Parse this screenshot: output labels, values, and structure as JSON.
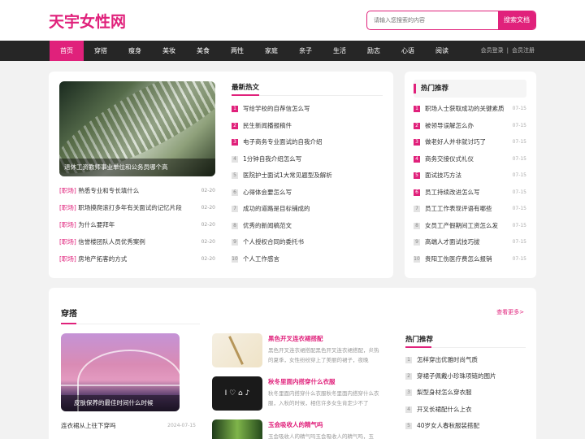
{
  "logo": "天宇女性网",
  "search": {
    "placeholder": "请输入您搜索的内容",
    "button": "搜索文档"
  },
  "nav": {
    "items": [
      "首页",
      "穿搭",
      "瘦身",
      "美妆",
      "美食",
      "两性",
      "家庭",
      "亲子",
      "生活",
      "励志",
      "心语",
      "阅读"
    ],
    "login": "会员登录",
    "register": "会员注册"
  },
  "feature": {
    "caption": "退休工资教师事业单位和公务员哪个高"
  },
  "left_list": [
    {
      "tag": "[职场]",
      "title": "熟悉专业和专长填什么",
      "date": "02-20"
    },
    {
      "tag": "[职场]",
      "title": "职场摸爬滚打多年有关面试的记忆片段",
      "date": "02-20"
    },
    {
      "tag": "[职场]",
      "title": "为什么要拜年",
      "date": "02-20"
    },
    {
      "tag": "[职场]",
      "title": "信誉楼团队人员优秀案例",
      "date": "02-20"
    },
    {
      "tag": "[职场]",
      "title": "房地产拓客的方式",
      "date": "02-20"
    }
  ],
  "latest": {
    "title": "最新热文",
    "items": [
      {
        "n": "1",
        "title": "写给学校的自荐信怎么写"
      },
      {
        "n": "2",
        "title": "民生新闻播报稿件"
      },
      {
        "n": "3",
        "title": "电子商务专业面试的自我介绍"
      },
      {
        "n": "4",
        "title": "1分钟自我介绍怎么写"
      },
      {
        "n": "5",
        "title": "医院护士面试1大常见题型及解析"
      },
      {
        "n": "6",
        "title": "心得体会要怎么写"
      },
      {
        "n": "7",
        "title": "成功的道路是目标铺成的"
      },
      {
        "n": "8",
        "title": "优秀的新闻稿范文"
      },
      {
        "n": "9",
        "title": "个人授权合同的委托书"
      },
      {
        "n": "10",
        "title": "个人工作感言"
      }
    ]
  },
  "hot": {
    "title": "热门推荐",
    "items": [
      {
        "n": "1",
        "title": "职场人士获取成功的关键素质",
        "date": "07-15"
      },
      {
        "n": "2",
        "title": "被领导误解怎么办",
        "date": "07-15"
      },
      {
        "n": "3",
        "title": "做老好人并非就讨巧了",
        "date": "07-15"
      },
      {
        "n": "4",
        "title": "商务交接仪式礼仪",
        "date": "07-15"
      },
      {
        "n": "5",
        "title": "面试技巧方法",
        "date": "07-15"
      },
      {
        "n": "6",
        "title": "员工持续改进怎么写",
        "date": "07-15"
      },
      {
        "n": "7",
        "title": "员工工作表现评语有哪些",
        "date": "07-15"
      },
      {
        "n": "8",
        "title": "女员工产假期间工资怎么发",
        "date": "07-15"
      },
      {
        "n": "9",
        "title": "高端人才面试技巧拔",
        "date": "07-15"
      },
      {
        "n": "10",
        "title": "贵阳工伤医疗费怎么报销",
        "date": "07-15"
      }
    ]
  },
  "section2": {
    "title": "穿搭",
    "more": "查看更多>",
    "feature_caption": "皮肤保养的最佳时间什么时候",
    "row": {
      "title": "连衣裙从上往下穿吗",
      "date": "2024-07-15"
    },
    "articles": [
      {
        "title": "黑色开叉连衣裙搭配",
        "desc": "黑色开叉连衣裙搭配黑色开叉连衣裙搭配，炎热的夏季，女性纷纷穿上了美丽的裙子，夜晚"
      },
      {
        "title": "秋冬里面内搭穿什么衣服",
        "desc": "秋冬里面内搭穿什么衣服秋冬里面内搭穿什么衣服，入秋的时候，相信许多女生肯定少不了"
      },
      {
        "title": "玉会吸收人的精气吗",
        "desc": "玉会吸收人的精气吗玉会吸收人的精气吗，玉"
      }
    ],
    "thumb2_icons": "I ♡ ⌂ ♪",
    "hot_title": "热门推荐",
    "hot_items": [
      {
        "n": "1",
        "title": "怎样穿出优雅时尚气质"
      },
      {
        "n": "2",
        "title": "穿裙子佩戴小珍珠项链的图片"
      },
      {
        "n": "3",
        "title": "梨型身材怎么穿衣服"
      },
      {
        "n": "4",
        "title": "开叉长裙配什么上衣"
      },
      {
        "n": "5",
        "title": "40岁女人春秋服装搭配"
      }
    ]
  }
}
